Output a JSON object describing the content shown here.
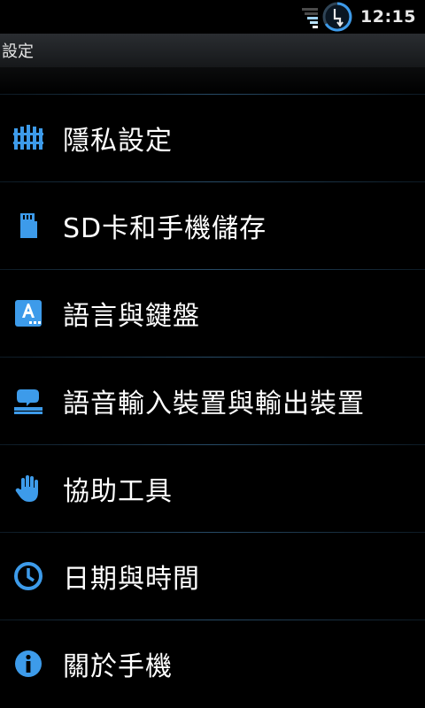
{
  "status_bar": {
    "time": "12:15",
    "signal_icon": "signal-bars-icon",
    "battery_icon": "charging-battery-icon"
  },
  "header": {
    "title": "設定"
  },
  "settings": {
    "items": [
      {
        "label": "隱私設定",
        "icon": "fence-icon"
      },
      {
        "label": "SD卡和手機儲存",
        "icon": "sd-card-icon"
      },
      {
        "label": "語言與鍵盤",
        "icon": "language-keyboard-icon"
      },
      {
        "label": "語音輸入裝置與輸出裝置",
        "icon": "voice-input-icon"
      },
      {
        "label": "協助工具",
        "icon": "hand-icon"
      },
      {
        "label": "日期與時間",
        "icon": "clock-icon"
      },
      {
        "label": "關於手機",
        "icon": "info-icon"
      }
    ]
  },
  "colors": {
    "accent": "#3d9bea",
    "divider": "#274b67",
    "background": "#000000"
  }
}
